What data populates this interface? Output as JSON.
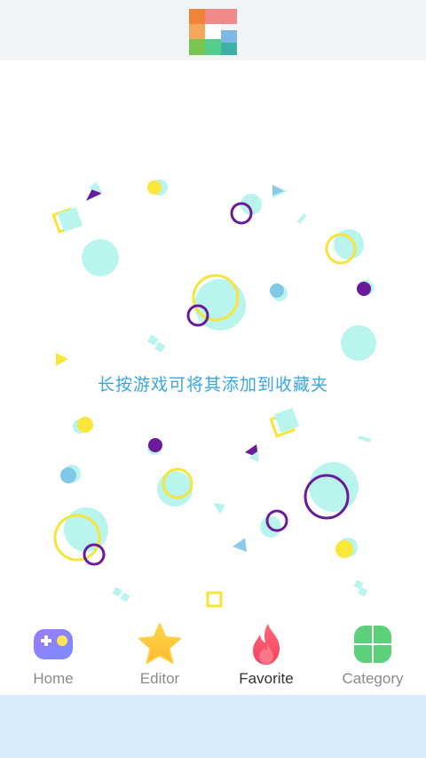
{
  "header": {
    "logo_icon": "app-logo-icon"
  },
  "main": {
    "empty_message": "长按游戏可将其添加到收藏夹"
  },
  "tabbar": {
    "tabs": [
      {
        "label": "Home",
        "icon": "gamepad-icon",
        "active": false
      },
      {
        "label": "Editor",
        "icon": "star-icon",
        "active": false
      },
      {
        "label": "Favorite",
        "icon": "flame-icon",
        "active": true
      },
      {
        "label": "Category",
        "icon": "clover-icon",
        "active": false
      }
    ]
  },
  "colors": {
    "accent_text": "#3aa6e0",
    "bottom_strip": "#d9ecfb",
    "header_bg": "#f1f5f8"
  }
}
